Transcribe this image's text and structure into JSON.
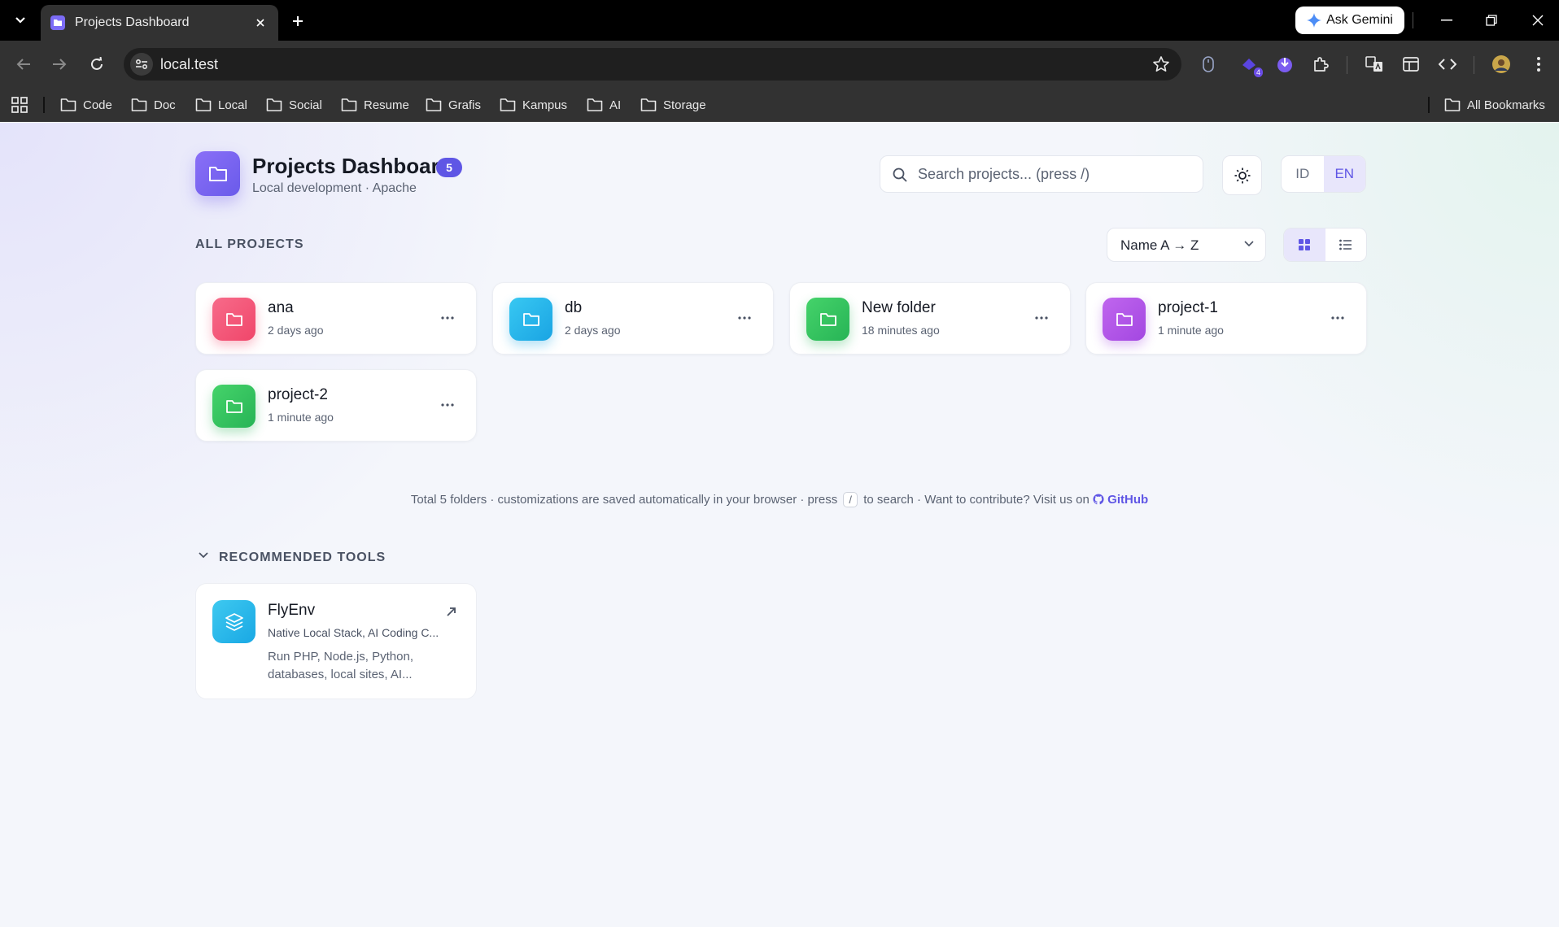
{
  "browser": {
    "tab_title": "Projects Dashboard",
    "gemini_label": "Ask Gemini",
    "url": "local.test",
    "extension_badge": "4",
    "bookmarks": [
      "Code",
      "Doc",
      "Local",
      "Social",
      "Resume",
      "Grafis",
      "Kampus",
      "AI",
      "Storage"
    ],
    "all_bookmarks": "All Bookmarks"
  },
  "header": {
    "title": "Projects Dashboard",
    "count": "5",
    "subtitle": "Local development · Apache"
  },
  "search": {
    "placeholder": "Search projects... (press /)"
  },
  "language": {
    "options": [
      "ID",
      "EN"
    ],
    "active": "EN"
  },
  "projects": {
    "section_label": "ALL PROJECTS",
    "sort_value": "Name A → Z",
    "items": [
      {
        "name": "ana",
        "time": "2 days ago",
        "color_from": "#f76b8a",
        "color_to": "#f0466a"
      },
      {
        "name": "db",
        "time": "2 days ago",
        "color_from": "#38c8f2",
        "color_to": "#1aa4e3"
      },
      {
        "name": "New folder",
        "time": "18 minutes ago",
        "color_from": "#45d36a",
        "color_to": "#27b456"
      },
      {
        "name": "project-1",
        "time": "1 minute ago",
        "color_from": "#c066ee",
        "color_to": "#a347e1"
      },
      {
        "name": "project-2",
        "time": "1 minute ago",
        "color_from": "#45d36a",
        "color_to": "#27b456"
      }
    ]
  },
  "footer": {
    "text_before": "Total 5 folders · customizations are saved automatically in your browser · press",
    "kbd": "/",
    "text_after": "to search · Want to contribute? Visit us on",
    "link": "GitHub"
  },
  "tools": {
    "section_label": "RECOMMENDED TOOLS",
    "items": [
      {
        "name": "FlyEnv",
        "tagline": "Native Local Stack, AI Coding C...",
        "description": "Run PHP, Node.js, Python, databases, local sites, AI..."
      }
    ]
  },
  "colors": {
    "accent": "#5f56e5",
    "accent_soft": "#e8e6fb"
  }
}
